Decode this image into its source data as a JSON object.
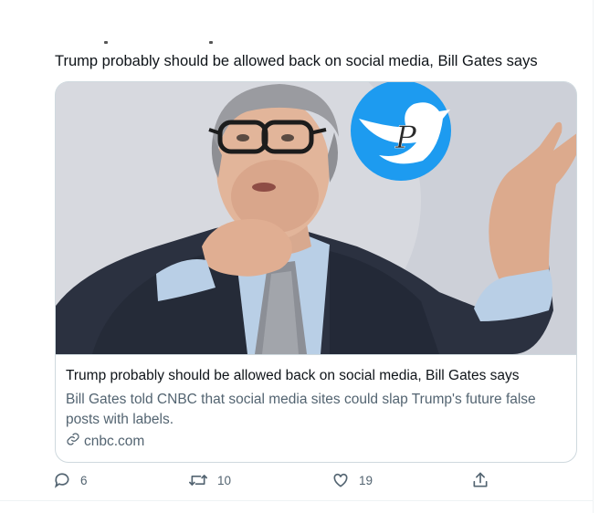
{
  "tweet": {
    "text": "Trump probably should be allowed back on social media, Bill Gates says"
  },
  "card": {
    "image_alt": "Bill Gates speaking, gesturing with raised hand",
    "watermark_icon": "twitter-bird-script-p-logo",
    "title": "Trump probably should be allowed back on social media, Bill Gates says",
    "description": "Bill Gates told CNBC that social media sites could slap Trump's future false posts with labels.",
    "domain": "cnbc.com",
    "domain_icon": "link-icon"
  },
  "actions": {
    "reply": {
      "icon": "reply-icon",
      "count": "6"
    },
    "retweet": {
      "icon": "retweet-icon",
      "count": "10"
    },
    "like": {
      "icon": "heart-icon",
      "count": "19"
    },
    "share": {
      "icon": "share-icon"
    }
  },
  "colors": {
    "text": "#0f1419",
    "secondary": "#536471",
    "border": "#cfd9de",
    "watermark_blue": "#1d9bf0"
  }
}
